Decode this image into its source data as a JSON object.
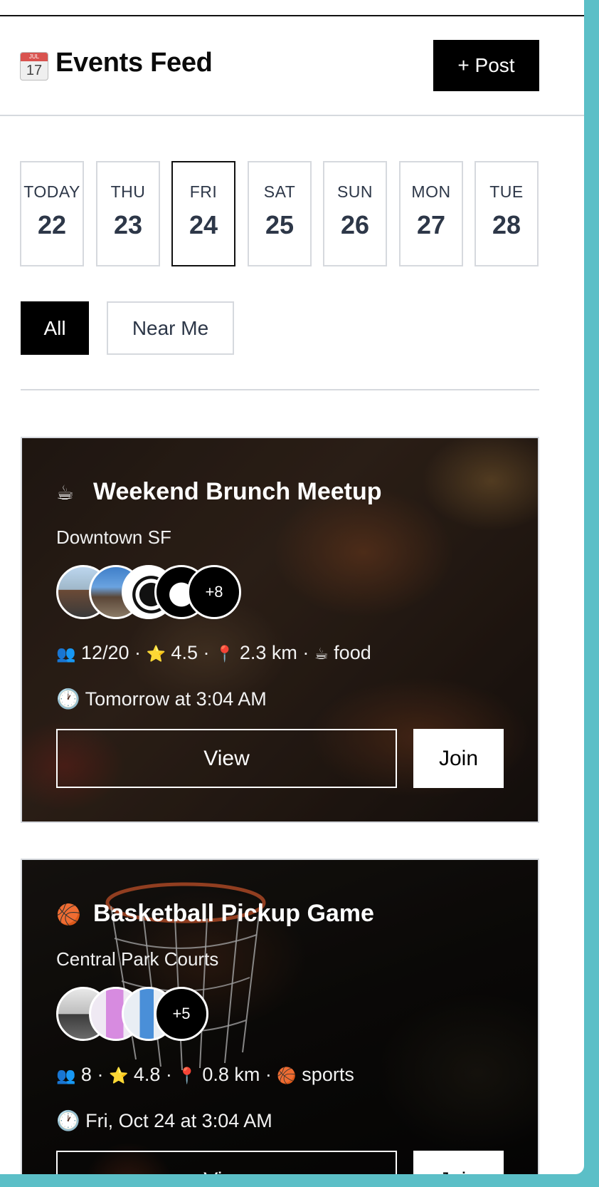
{
  "header": {
    "calendar_icon": {
      "month": "JUL",
      "day": "17"
    },
    "title": "Events Feed",
    "post_label": "+ Post"
  },
  "days": [
    {
      "name": "TODAY",
      "num": "22",
      "selected": false
    },
    {
      "name": "THU",
      "num": "23",
      "selected": false
    },
    {
      "name": "FRI",
      "num": "24",
      "selected": true
    },
    {
      "name": "SAT",
      "num": "25",
      "selected": false
    },
    {
      "name": "SUN",
      "num": "26",
      "selected": false
    },
    {
      "name": "MON",
      "num": "27",
      "selected": false
    },
    {
      "name": "TUE",
      "num": "28",
      "selected": false
    }
  ],
  "filters": {
    "all": "All",
    "near": "Near Me",
    "active": "All"
  },
  "events": [
    {
      "emoji": "☕",
      "title": "Weekend Brunch Meetup",
      "location": "Downtown SF",
      "avatars_more": "+8",
      "attendees_icon": "👥",
      "attendees": "12/20",
      "rating_icon": "⭐",
      "rating": "4.5",
      "distance_icon": "📍",
      "distance": "2.3 km",
      "category_icon": "☕",
      "category": "food",
      "time_icon": "🕐",
      "time": "Tomorrow at 3:04 AM",
      "view_label": "View",
      "join_label": "Join"
    },
    {
      "emoji": "🏀",
      "title": "Basketball Pickup Game",
      "location": "Central Park Courts",
      "avatars_more": "+5",
      "attendees_icon": "👥",
      "attendees": "8",
      "rating_icon": "⭐",
      "rating": "4.8",
      "distance_icon": "📍",
      "distance": "0.8 km",
      "category_icon": "🏀",
      "category": "sports",
      "time_icon": "🕐",
      "time": "Fri, Oct 24 at 3:04 AM",
      "view_label": "View",
      "join_label": "Join"
    }
  ],
  "colors": {
    "accent": "#000000",
    "background": "#5bbfc7",
    "border": "#d6d9de",
    "text": "#2d3748"
  }
}
